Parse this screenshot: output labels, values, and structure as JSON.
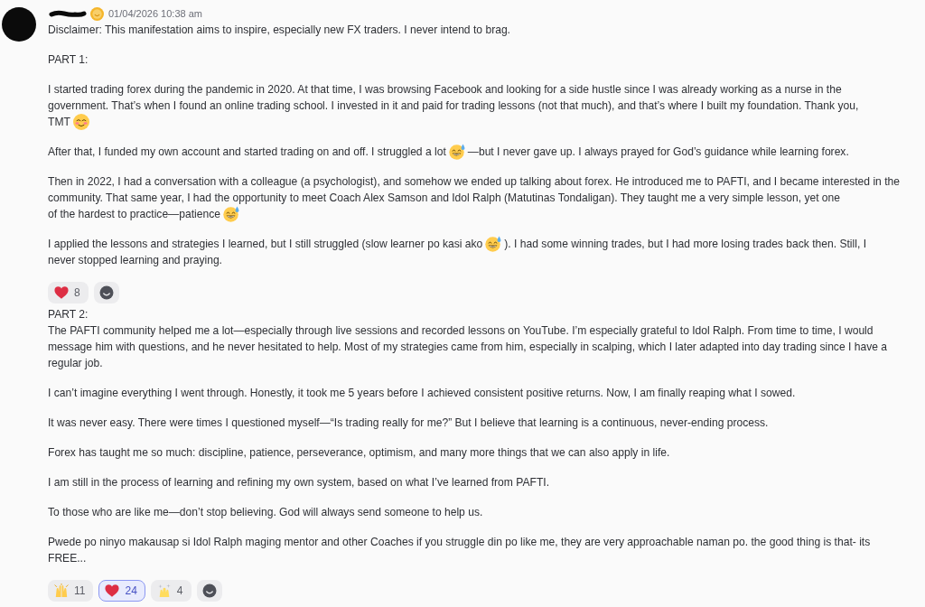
{
  "messages": [
    {
      "header": {
        "timestamp": "01/04/2026 10:38 am"
      },
      "paragraphs": [
        {
          "text": "Disclaimer: This manifestation aims to inspire, especially new FX traders. I never intend to brag."
        },
        {
          "text": "PART 1:"
        },
        {
          "lines": [
            {
              "parts": [
                {
                  "kind": "text",
                  "text": "I started trading forex during the pandemic in 2020. At that time, I was browsing Facebook and looking for a side hustle since I was already working as a nurse in the"
                }
              ]
            },
            {
              "parts": [
                {
                  "kind": "text",
                  "text": "government. That’s when I found an online trading school. I invested in it and paid for trading lessons (not that much), and that’s where I built my foundation. Thank you,"
                }
              ]
            },
            {
              "parts": [
                {
                  "kind": "text",
                  "text": "TMT"
                },
                {
                  "kind": "blush"
                }
              ]
            }
          ]
        },
        {
          "lines": [
            {
              "parts": [
                {
                  "kind": "text",
                  "text": "After that, I funded my own account and started trading on and off. I struggled a lot"
                },
                {
                  "kind": "sweat_smile"
                },
                {
                  "kind": "text",
                  "text": "—but I never gave up. I always prayed for God’s guidance while learning forex."
                }
              ]
            }
          ]
        },
        {
          "lines": [
            {
              "parts": [
                {
                  "kind": "text",
                  "text": "Then in 2022, I had a conversation with a colleague (a psychologist), and somehow we ended up talking about forex. He introduced me to PAFTI, and I became interested in the"
                }
              ]
            },
            {
              "parts": [
                {
                  "kind": "text",
                  "text": "community. That same year, I had the opportunity to meet Coach Alex Samson and Idol Ralph (Matutinas Tondaligan). They taught me a very simple lesson, yet one"
                }
              ]
            },
            {
              "parts": [
                {
                  "kind": "text",
                  "text": "of the hardest to practice—patience"
                },
                {
                  "kind": "sweat_smile"
                }
              ]
            }
          ]
        },
        {
          "lines": [
            {
              "parts": [
                {
                  "kind": "text",
                  "text": "I applied the lessons and strategies I learned, but I still struggled (slow learner po kasi ako"
                },
                {
                  "kind": "sweat_smile"
                },
                {
                  "kind": "text",
                  "text": "). I had some winning trades, but I had more losing trades back then. Still, I"
                }
              ]
            },
            {
              "parts": [
                {
                  "kind": "text",
                  "text": "never stopped learning and praying."
                }
              ]
            }
          ]
        }
      ],
      "reactions": [
        {
          "kind": "heart",
          "count": "8",
          "selected": false
        }
      ]
    },
    {
      "paragraphs": [
        {
          "text": "PART 2:\nThe PAFTI community helped me a lot—especially through live sessions and recorded lessons on YouTube. I’m especially grateful to Idol Ralph. From time to time, I would message him with questions, and he never hesitated to help. Most of my strategies came from him, especially in scalping, which I later adapted into day trading since I have a regular job."
        },
        {
          "text": "I can’t imagine everything I went through. Honestly, it took me 5 years before I achieved consistent positive returns. Now, I am finally reaping what I sowed."
        },
        {
          "text": "It was never easy. There were times I questioned myself—“Is trading really for me?” But I believe that learning is a continuous, never-ending process."
        },
        {
          "text": "Forex has taught me so much: discipline, patience, perseverance, optimism, and many more things that we can also apply in life."
        },
        {
          "text": "I am still in the process of learning and refining my own system, based on what I’ve learned from PAFTI."
        },
        {
          "text": "To those who are like me—don’t stop believing. God will always send someone to help us."
        },
        {
          "text": "Pwede po ninyo makausap si Idol Ralph maging mentor and other Coaches if you struggle din po like me, they are very approachable naman po. the good thing is that- its FREE..."
        }
      ],
      "reactions": [
        {
          "kind": "hands",
          "count": "11",
          "selected": false
        },
        {
          "kind": "heart",
          "count": "24",
          "selected": true
        },
        {
          "kind": "sparkle_hands",
          "count": "4",
          "selected": false
        }
      ]
    }
  ]
}
